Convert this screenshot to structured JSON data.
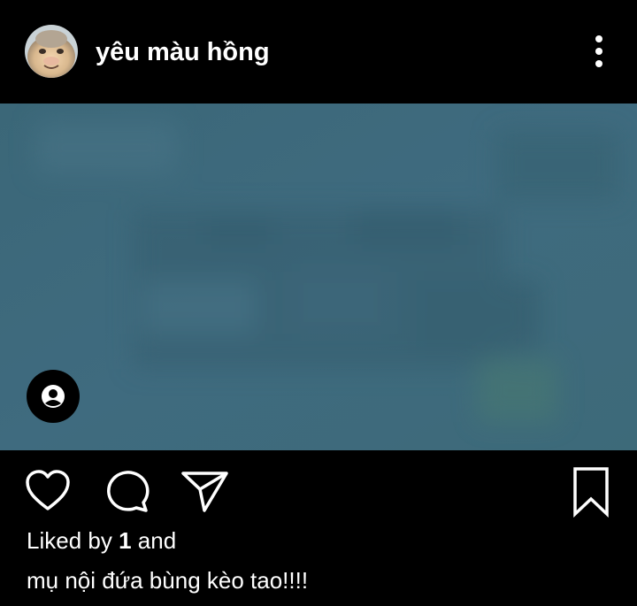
{
  "post": {
    "username": "yêu màu hồng",
    "avatar_icon": "cat-face-avatar",
    "more_icon": "more-vertical-icon",
    "media": {
      "description_icon": "blurred-video-frame",
      "base_color": "#3f6b7f",
      "tag_icon": "user-tag-icon"
    },
    "actions": {
      "like_icon": "heart-outline-icon",
      "comment_icon": "comment-bubble-icon",
      "share_icon": "paper-plane-icon",
      "save_icon": "bookmark-outline-icon"
    },
    "likes": {
      "prefix": "Liked by",
      "count": "1",
      "suffix": "and"
    },
    "caption": "mụ nội đứa bùng kèo tao!!!!"
  },
  "colors": {
    "background": "#000000",
    "text": "#ffffff",
    "media": "#3f6b7f"
  }
}
